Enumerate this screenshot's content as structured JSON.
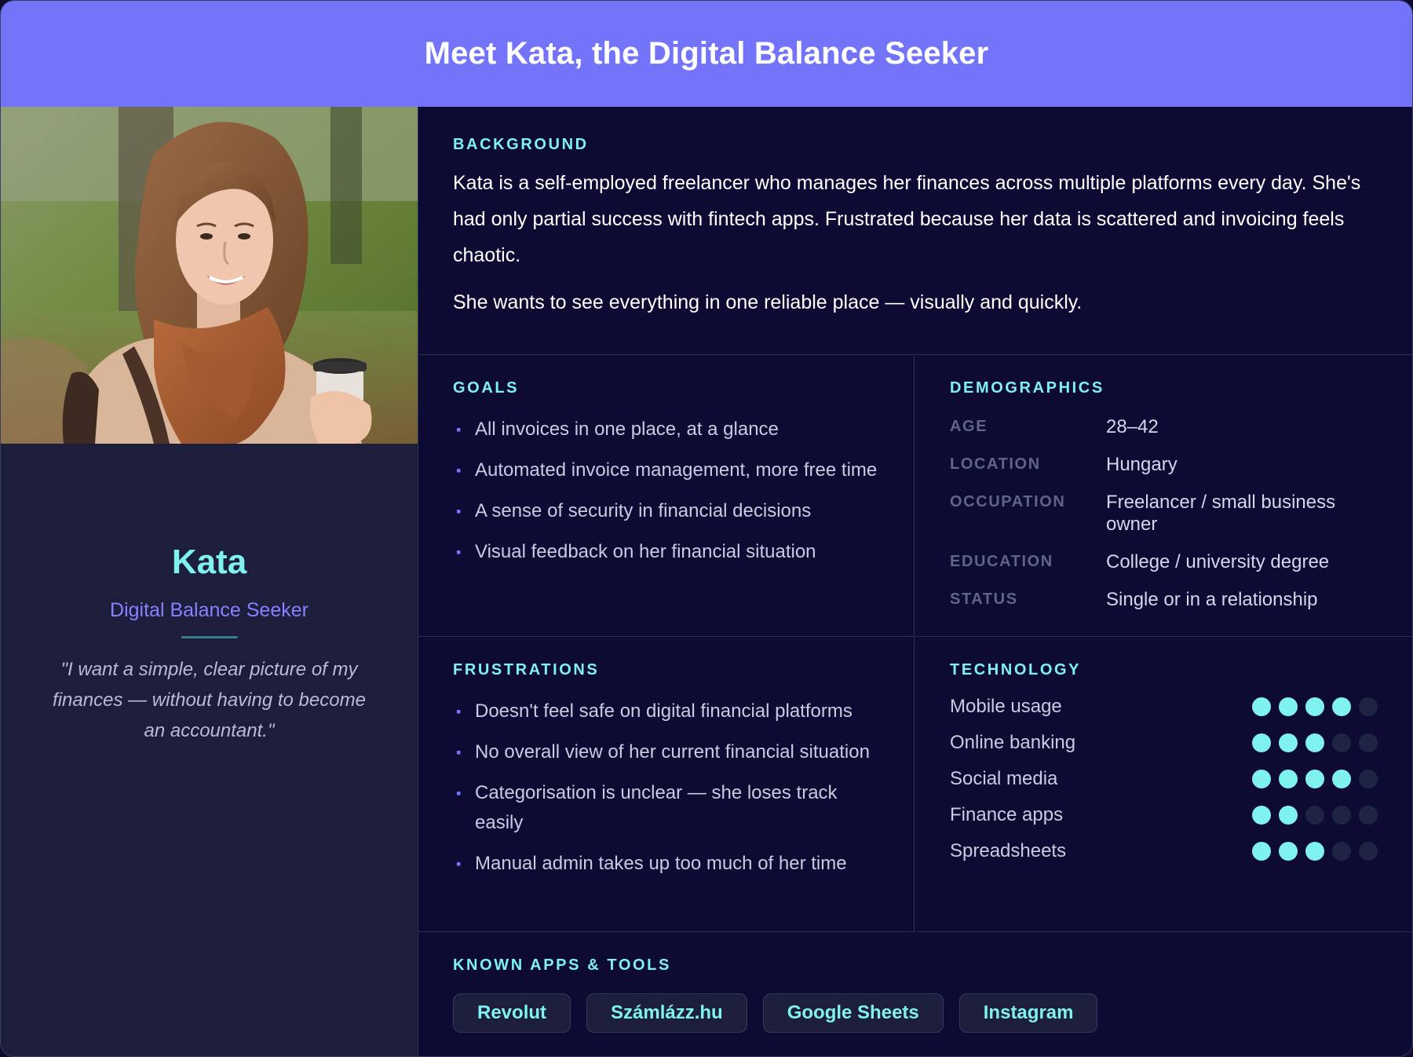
{
  "header": {
    "title": "Meet Kata, the Digital Balance Seeker"
  },
  "profile": {
    "photo_alt": "portrait-photo",
    "name": "Kata",
    "role": "Digital Balance Seeker",
    "quote": "\"I want a simple, clear picture of my finances — without having to become an accountant.\""
  },
  "background": {
    "title": "BACKGROUND",
    "paragraph1": "Kata is a self-employed freelancer who manages her finances across multiple platforms every day. She's had only partial success with fintech apps. Frustrated because her data is scattered and invoicing feels chaotic.",
    "paragraph2": "She wants to see everything in one reliable place — visually and quickly."
  },
  "goals": {
    "title": "GOALS",
    "items": [
      "All invoices in one place, at a glance",
      "Automated invoice management, more free time",
      "A sense of security in financial decisions",
      "Visual feedback on her financial situation"
    ]
  },
  "demographics": {
    "title": "DEMOGRAPHICS",
    "rows": [
      {
        "label": "AGE",
        "value": "28–42"
      },
      {
        "label": "LOCATION",
        "value": "Hungary"
      },
      {
        "label": "OCCUPATION",
        "value": "Freelancer / small business owner"
      },
      {
        "label": "EDUCATION",
        "value": "College / university degree"
      },
      {
        "label": "STATUS",
        "value": "Single or in a relationship"
      }
    ]
  },
  "frustrations": {
    "title": "FRUSTRATIONS",
    "items": [
      "Doesn't feel safe on digital financial platforms",
      "No overall view of her current financial situation",
      "Categorisation is unclear — she loses track easily",
      "Manual admin takes up too much of her time"
    ]
  },
  "technology": {
    "title": "TECHNOLOGY",
    "rows": [
      {
        "label": "Mobile usage",
        "level": 4,
        "max": 5
      },
      {
        "label": "Online banking",
        "level": 3,
        "max": 5
      },
      {
        "label": "Social media",
        "level": 4,
        "max": 5
      },
      {
        "label": "Finance apps",
        "level": 2,
        "max": 5
      },
      {
        "label": "Spreadsheets",
        "level": 3,
        "max": 5
      }
    ]
  },
  "tools": {
    "title": "KNOWN APPS & TOOLS",
    "items": [
      "Revolut",
      "Számlázz.hu",
      "Google Sheets",
      "Instagram"
    ]
  },
  "colors": {
    "header": "#7474fb",
    "accent": "#7ff2f0",
    "role": "#8a80ff",
    "panel": "#1c1e3c",
    "background": "#0d0b33"
  }
}
